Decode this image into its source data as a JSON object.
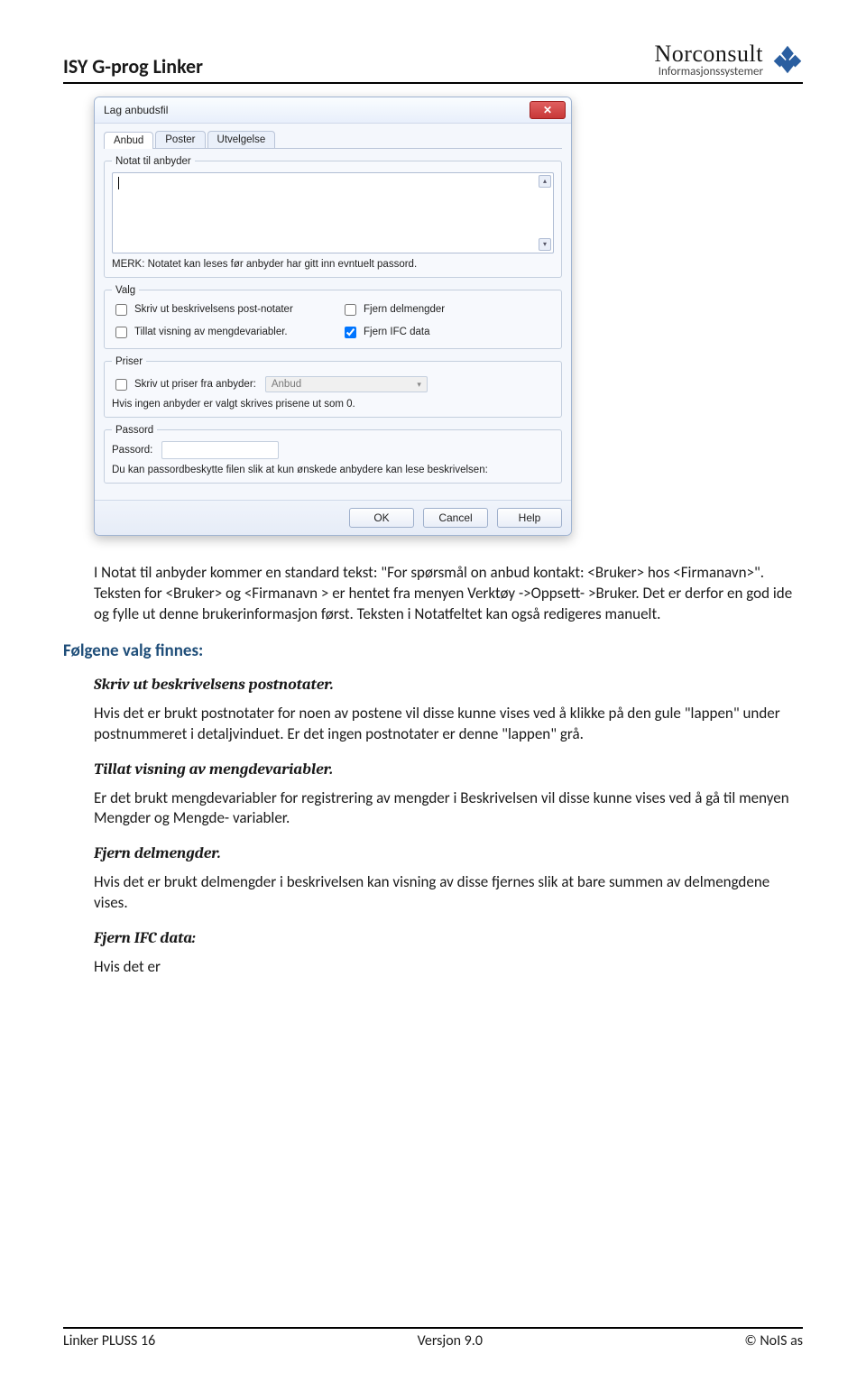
{
  "header": {
    "title": "ISY G-prog Linker",
    "brand_line1": "Norconsult",
    "brand_line2": "Informasjonssystemer"
  },
  "dialog": {
    "title": "Lag anbudsfil",
    "close_aria": "Close",
    "tabs": [
      "Anbud",
      "Poster",
      "Utvelgelse"
    ],
    "notat": {
      "legend": "Notat til anbyder",
      "note": "MERK: Notatet kan leses før anbyder har gitt inn evntuelt passord."
    },
    "valg": {
      "legend": "Valg",
      "opt1": "Skriv ut beskrivelsens post-notater",
      "opt2": "Fjern delmengder",
      "opt3": "Tillat visning av mengdevariabler.",
      "opt4": "Fjern IFC data"
    },
    "priser": {
      "legend": "Priser",
      "chk": "Skriv ut priser fra anbyder:",
      "select": "Anbud",
      "note": "Hvis ingen anbyder er valgt skrives prisene ut som 0."
    },
    "passord": {
      "legend": "Passord",
      "label": "Passord:",
      "note": "Du kan passordbeskytte filen slik at kun ønskede anbydere kan lese beskrivelsen:"
    },
    "buttons": {
      "ok": "OK",
      "cancel": "Cancel",
      "help": "Help"
    }
  },
  "content": {
    "intro": "I Notat til anbyder kommer en standard tekst: \"For spørsmål on anbud kontakt: <Bruker> hos <Firmanavn>\". Teksten for <Bruker> og <Firmanavn > er hentet fra menyen Verktøy ->Oppsett- >Bruker. Det er derfor en god ide og fylle ut denne brukerinformasjon først. Teksten i Notatfeltet kan også redigeres manuelt.",
    "section_heading": "Følgene valg finnes:",
    "sub1_title": "Skriv ut beskrivelsens postnotater.",
    "sub1_body": "Hvis det er brukt postnotater for noen av postene vil disse kunne vises ved å klikke på den gule \"lappen\" under postnummeret i detaljvinduet. Er det ingen postnotater er denne \"lappen\" grå.",
    "sub2_title": "Tillat visning av mengdevariabler.",
    "sub2_body": "Er det brukt mengdevariabler for registrering av mengder i Beskrivelsen vil disse kunne vises ved å gå til menyen Mengder og Mengde- variabler.",
    "sub3_title": "Fjern delmengder.",
    "sub3_body": "Hvis det er brukt delmengder i beskrivelsen kan visning av disse fjernes slik at bare summen av delmengdene vises.",
    "sub4_title": "Fjern IFC data:",
    "sub4_body": "Hvis det er"
  },
  "footer": {
    "left": "Linker PLUSS 16",
    "center": "Versjon 9.0",
    "right": "© NoIS as"
  }
}
